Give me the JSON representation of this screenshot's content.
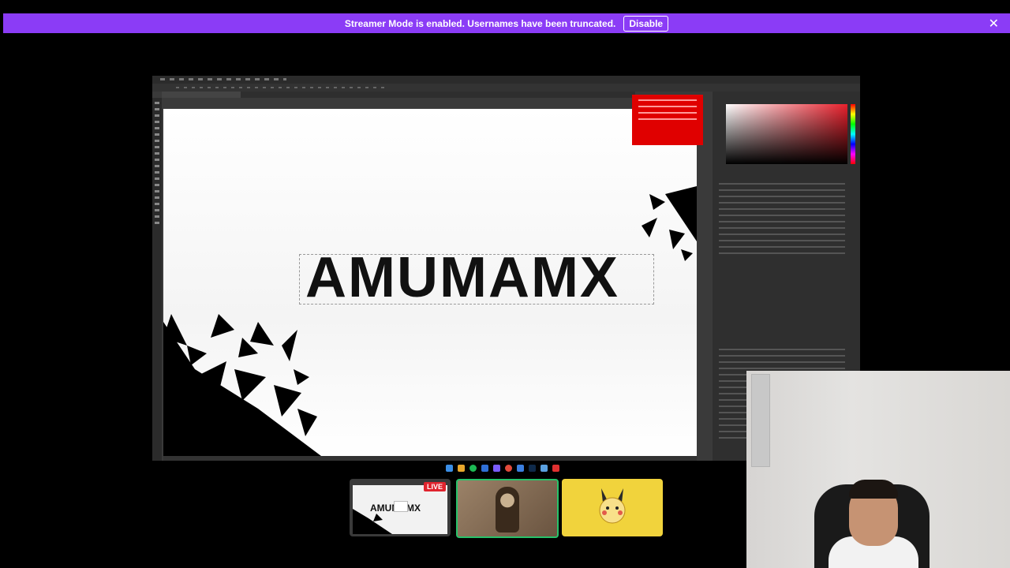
{
  "banner": {
    "message": "Streamer Mode is enabled. Usernames have been truncated.",
    "disable_label": "Disable",
    "close_glyph": "✕",
    "color": "#8b3cf6"
  },
  "screen_share": {
    "canvas_text": "AMUMAMX"
  },
  "thumbnails": {
    "live_badge": "LIVE",
    "screen_label": "AMUMAMX"
  }
}
